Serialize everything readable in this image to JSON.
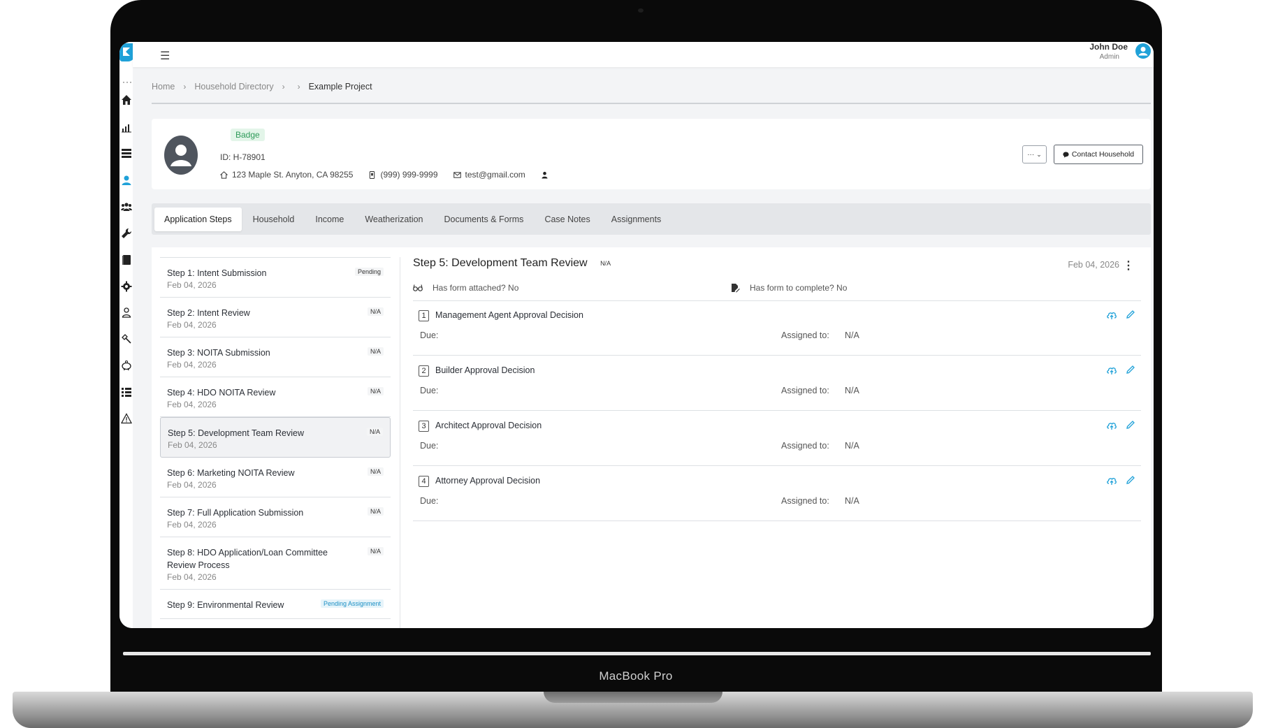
{
  "device": {
    "brand": "MacBook Pro"
  },
  "header": {
    "user_name": "John Doe",
    "user_role": "Admin"
  },
  "sidebar": {
    "icons": [
      "logo-icon",
      "more-icon",
      "home-icon",
      "chart-icon",
      "table-icon",
      "person-icon",
      "users-icon",
      "wrench-icon",
      "book-icon",
      "gear-icon",
      "user-outline-icon",
      "hammer-icon",
      "piggy-bank-icon",
      "list-icon",
      "warning-icon"
    ],
    "active": "person-icon",
    "accent": "#1fa1d8"
  },
  "breadcrumb": {
    "home": "Home",
    "directory": "Household Directory",
    "current": "Example Project"
  },
  "profile": {
    "badge": "Badge",
    "id": "ID: H-78901",
    "address": "123 Maple St. Anyton, CA 98255",
    "phone": "(999) 999-9999",
    "email": "test@gmail.com",
    "more_label": "···",
    "contact_button": "Contact Household"
  },
  "tabs": [
    {
      "label": "Application Steps",
      "active": true
    },
    {
      "label": "Household"
    },
    {
      "label": "Income"
    },
    {
      "label": "Weatherization"
    },
    {
      "label": "Documents & Forms"
    },
    {
      "label": "Case Notes"
    },
    {
      "label": "Assignments"
    }
  ],
  "steps": [
    {
      "title": "Step 1: Intent Submission",
      "date": "Feb 04, 2026",
      "status": "Pending"
    },
    {
      "title": "Step 2: Intent Review",
      "date": "Feb 04, 2026",
      "status": "N/A"
    },
    {
      "title": "Step 3: NOITA Submission",
      "date": "Feb 04, 2026",
      "status": "N/A"
    },
    {
      "title": "Step 4: HDO NOITA Review",
      "date": "Feb 04, 2026",
      "status": "N/A"
    },
    {
      "title": "Step 5: Development Team Review",
      "date": "Feb 04, 2026",
      "status": "N/A",
      "selected": true
    },
    {
      "title": "Step 6: Marketing NOITA Review",
      "date": "Feb 04, 2026",
      "status": "N/A"
    },
    {
      "title": "Step 7: Full Application Submission",
      "date": "Feb 04, 2026",
      "status": "N/A"
    },
    {
      "title": "Step 8: HDO Application/Loan Committee Review Process",
      "date": "Feb 04, 2026",
      "status": "N/A"
    },
    {
      "title": "Step 9: Environmental Review",
      "date": "",
      "status": "Pending Assignment"
    }
  ],
  "detail": {
    "title": "Step 5: Development Team Review",
    "status": "N/A",
    "date": "Feb 04, 2026",
    "form_attached": "Has form attached? No",
    "form_to_complete": "Has form to complete? No",
    "due_label": "Due:",
    "assigned_label": "Assigned to:",
    "tasks": [
      {
        "num": "1",
        "title": "Management Agent Approval Decision",
        "assignee": "N/A"
      },
      {
        "num": "2",
        "title": "Builder Approval Decision",
        "assignee": "N/A"
      },
      {
        "num": "3",
        "title": "Architect Approval Decision",
        "assignee": "N/A"
      },
      {
        "num": "4",
        "title": "Attorney Approval Decision",
        "assignee": "N/A"
      }
    ]
  }
}
